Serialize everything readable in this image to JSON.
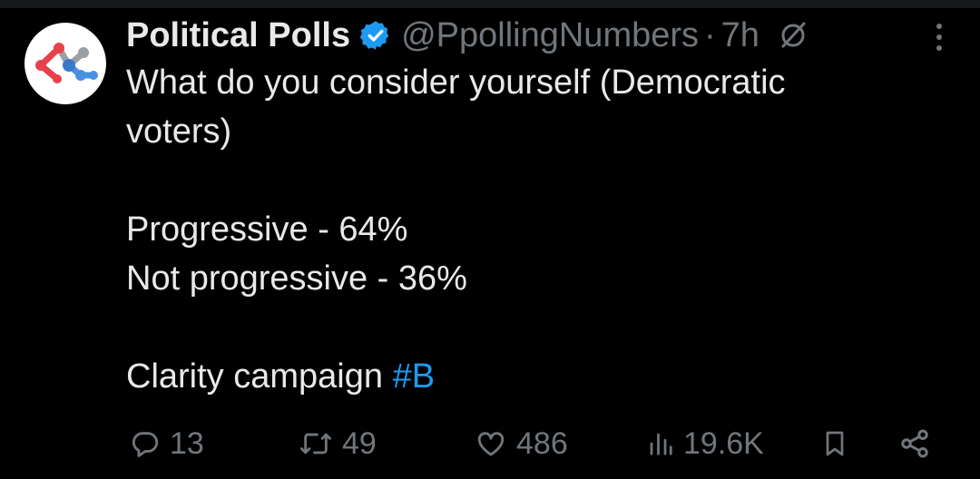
{
  "author": {
    "display_name": "Political Polls",
    "handle": "@PpollingNumbers",
    "separator": "·",
    "time": "7h",
    "verified": true,
    "avatar_icon": "network-logo-icon"
  },
  "tweet": {
    "lines": [
      "What do you consider yourself (Democratic",
      "voters)",
      "",
      "Progressive - 64%",
      "Not progressive - 36%",
      "",
      "Clarity campaign "
    ],
    "hashtag": "#B"
  },
  "actions": {
    "replies": "13",
    "reposts": "49",
    "likes": "486",
    "views": "19.6K"
  },
  "colors": {
    "background": "#000000",
    "text": "#e7e9ea",
    "muted": "#71767b",
    "accent": "#1d9bf0"
  }
}
